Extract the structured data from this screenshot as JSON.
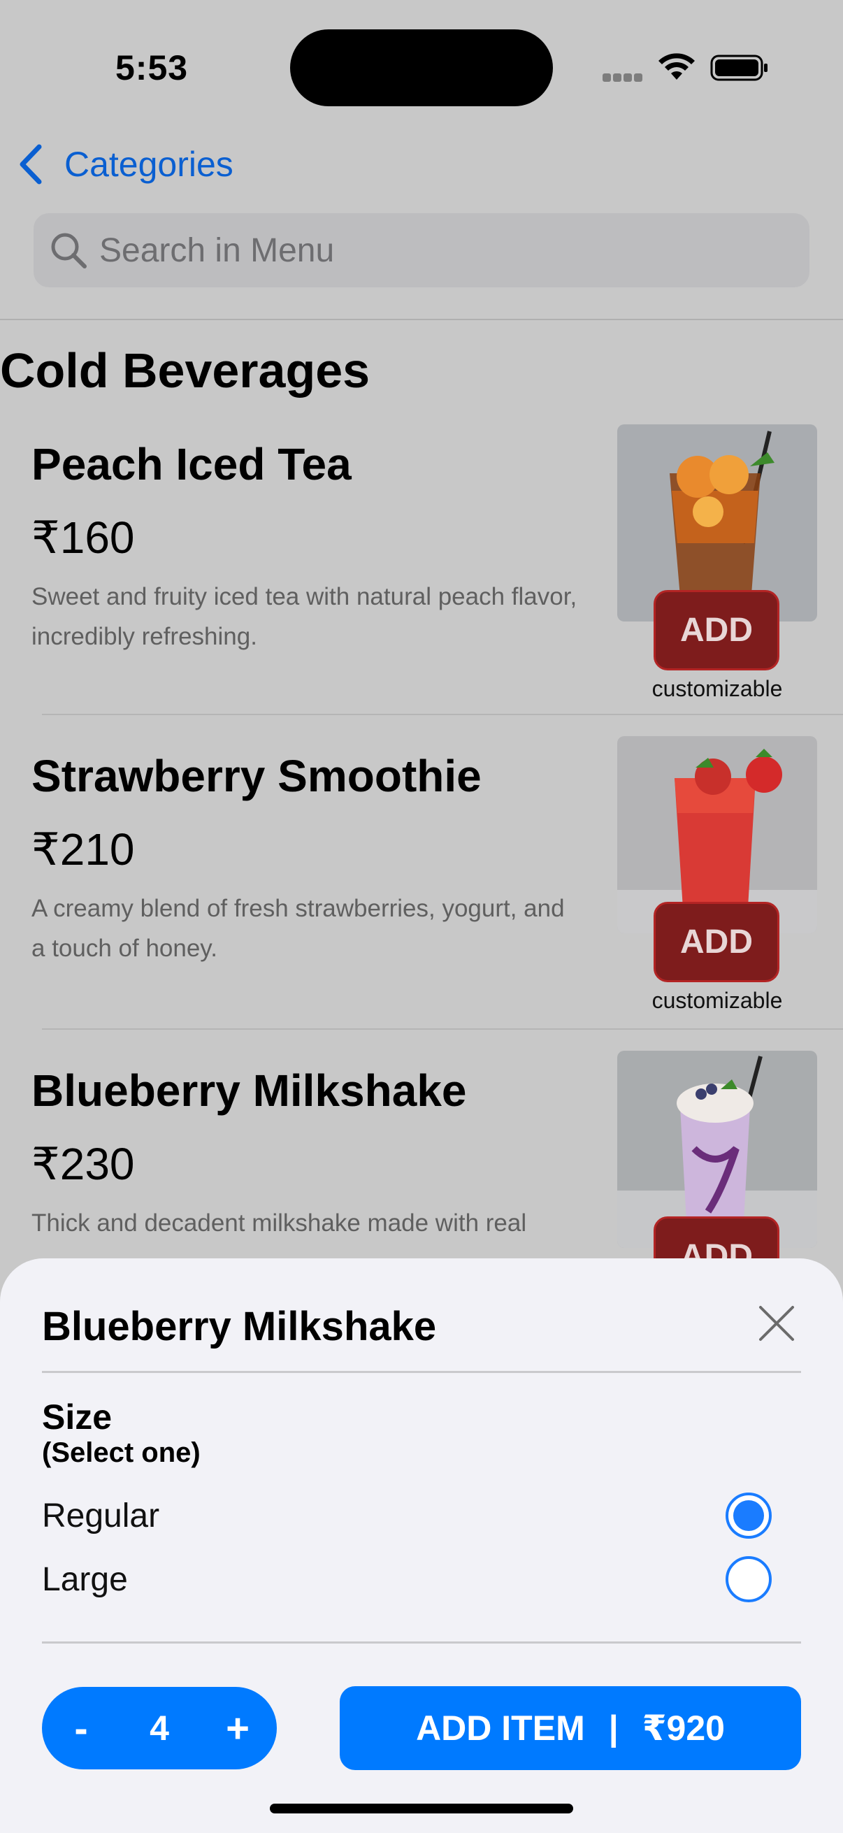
{
  "status_bar": {
    "time": "5:53"
  },
  "nav": {
    "back_label": "Categories"
  },
  "search": {
    "placeholder": "Search in Menu"
  },
  "section": {
    "title": "Cold Beverages"
  },
  "items": [
    {
      "name": "Peach Iced Tea",
      "price": "₹160",
      "description": "Sweet and fruity iced tea with natural peach flavor, incredibly refreshing.",
      "add_label": "ADD",
      "customizable_label": "customizable",
      "image_icon": "peach-iced-tea-image"
    },
    {
      "name": "Strawberry Smoothie",
      "price": "₹210",
      "description": "A creamy blend of fresh strawberries, yogurt, and a touch of honey.",
      "add_label": "ADD",
      "customizable_label": "customizable",
      "image_icon": "strawberry-smoothie-image"
    },
    {
      "name": "Blueberry Milkshake",
      "price": "₹230",
      "description": "Thick and decadent milkshake made with real",
      "add_label": "ADD",
      "image_icon": "blueberry-milkshake-image"
    }
  ],
  "sheet": {
    "title": "Blueberry Milkshake",
    "size_label": "Size",
    "size_sub": "(Select one)",
    "options": [
      {
        "label": "Regular",
        "selected": true
      },
      {
        "label": "Large",
        "selected": false
      }
    ],
    "quantity": "4",
    "minus_label": "-",
    "plus_label": "+",
    "add_button_label": "ADD ITEM",
    "add_button_separator": "|",
    "add_button_total": "₹920"
  },
  "colors": {
    "accent_blue": "#007aff",
    "add_button_red": "#7e1c1c",
    "link_blue": "#0a5fd1"
  }
}
